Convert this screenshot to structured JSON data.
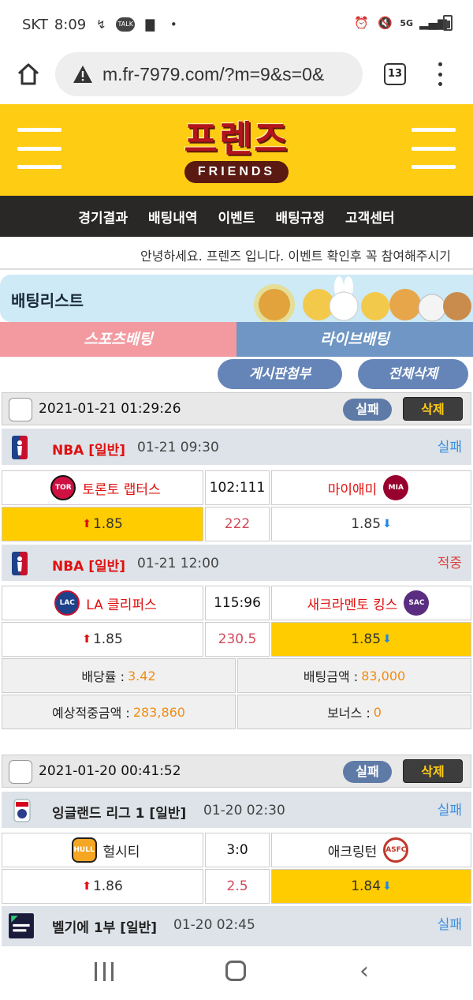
{
  "status_bar": {
    "carrier": "SKT",
    "time": "8:09",
    "talk": "TALK",
    "network": "5G"
  },
  "browser": {
    "url": "m.fr-7979.com/?m=9&s=0&",
    "tab_count": "13"
  },
  "site": {
    "logo_ko": "프렌즈",
    "logo_en": "FRIENDS",
    "brand_color": "#ffcc14"
  },
  "nav": [
    "경기결과",
    "배팅내역",
    "이벤트",
    "배팅규정",
    "고객센터"
  ],
  "ticker": "안녕하세요. 프렌즈 입니다. 이벤트 확인후 꼭 참여해주시기",
  "banner": {
    "title": "배팅리스트"
  },
  "bet_tabs": {
    "sports": "스포츠배팅",
    "live": "라이브배팅"
  },
  "actions": {
    "board_attach": "게시판첨부",
    "delete_all": "전체삭제"
  },
  "slips": [
    {
      "datetime": "2021-01-21 01:29:26",
      "status": "실패",
      "delete": "삭제",
      "games": [
        {
          "league": "NBA [일반]",
          "time": "01-21 09:30",
          "result": "실패",
          "result_color": "#3b8ee0",
          "home": "토론토 랩터스",
          "away": "마이애미",
          "score": "102:111",
          "home_odd": "1.85",
          "line": "222",
          "away_odd": "1.85"
        },
        {
          "league": "NBA [일반]",
          "time": "01-21 12:00",
          "result": "적중",
          "result_color": "#e04040",
          "home": "LA 클리퍼스",
          "away": "새크라멘토 킹스",
          "score": "115:96",
          "home_odd": "1.85",
          "line": "230.5",
          "away_odd": "1.85"
        }
      ],
      "summary": {
        "odds_label": "배당률 :",
        "odds": "3.42",
        "bet_label": "배팅금액 :",
        "bet": "83,000",
        "expected_label": "예상적중금액 :",
        "expected": "283,860",
        "bonus_label": "보너스 :",
        "bonus": "0"
      }
    },
    {
      "datetime": "2021-01-20 00:41:52",
      "status": "실패",
      "delete": "삭제",
      "games": [
        {
          "league": "잉글랜드 리그 1 [일반]",
          "time": "01-20 02:30",
          "result": "실패",
          "result_color": "#3b8ee0",
          "home": "헐시티",
          "away": "애크링턴",
          "score": "3:0",
          "home_odd": "1.86",
          "line": "2.5",
          "away_odd": "1.84"
        },
        {
          "league": "벨기에 1부 [일반]",
          "time": "01-20 02:45",
          "result": "실패",
          "result_color": "#3b8ee0"
        }
      ]
    }
  ]
}
